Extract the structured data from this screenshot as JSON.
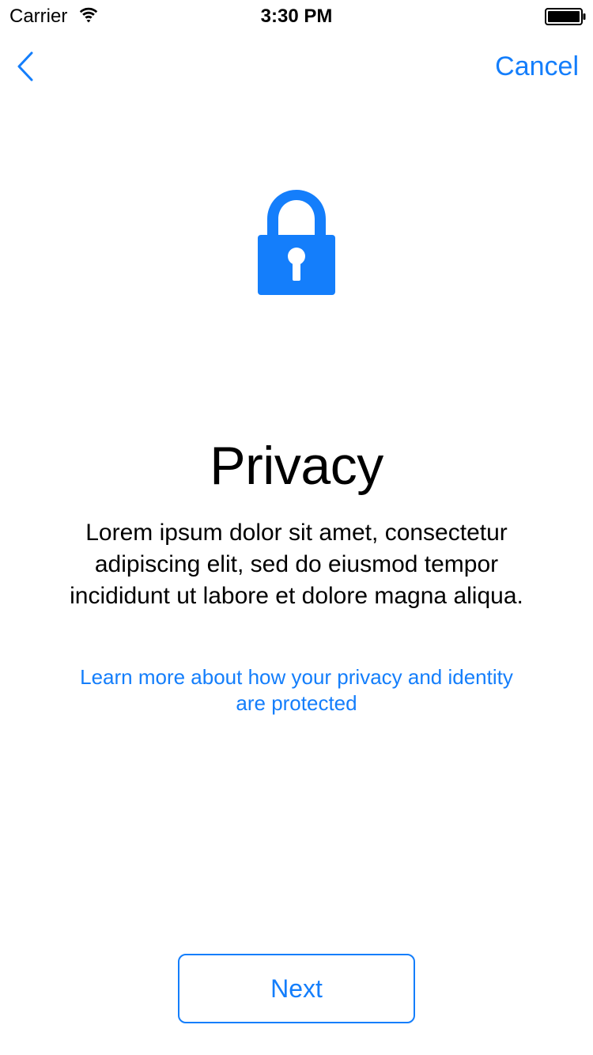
{
  "status_bar": {
    "carrier": "Carrier",
    "time": "3:30 PM",
    "wifi_icon": "wifi-icon",
    "battery_icon": "battery-full-icon"
  },
  "nav": {
    "back_icon": "chevron-left-icon",
    "cancel_label": "Cancel"
  },
  "hero": {
    "icon": "lock-icon",
    "icon_color": "#147EFB"
  },
  "content": {
    "title": "Privacy",
    "body": "Lorem ipsum dolor sit amet, consectetur adipiscing elit, sed do eiusmod tempor incididunt ut labore et dolore magna aliqua.",
    "learn_more_link": "Learn more about how your privacy and identity are protected"
  },
  "footer": {
    "next_label": "Next"
  },
  "colors": {
    "accent": "#147EFB",
    "text": "#000000",
    "background": "#FFFFFF"
  }
}
